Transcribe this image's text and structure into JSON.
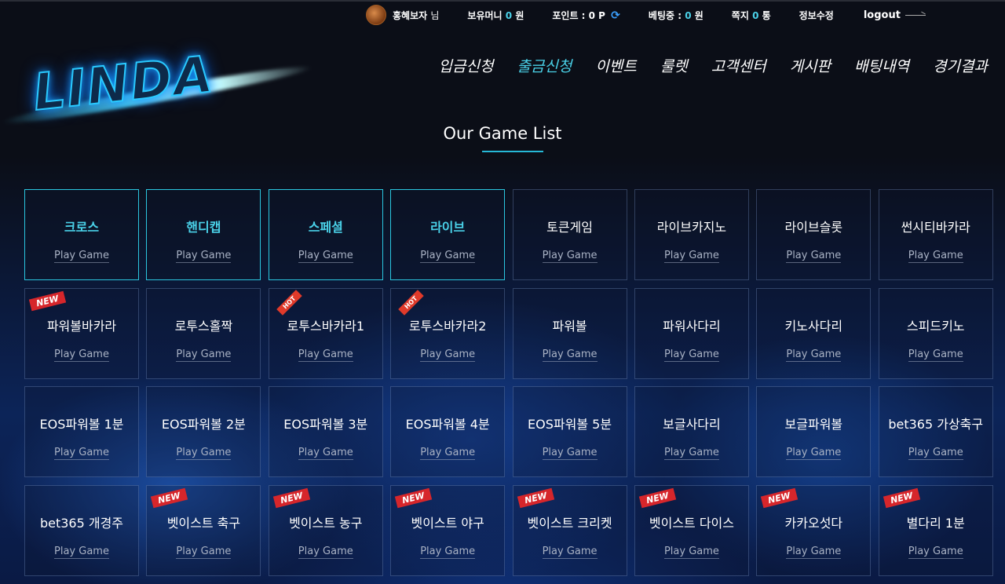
{
  "topbar": {
    "username": "홍혜보자",
    "user_suffix": "님",
    "money_label": "보유머니",
    "money_value": "0",
    "money_unit": "원",
    "point_label": "포인트 :",
    "point_value": "0 P",
    "betting_label": "베팅중 :",
    "betting_value": "0",
    "betting_unit": "원",
    "message_label": "쪽지",
    "message_value": "0",
    "message_unit": "통",
    "edit_label": "정보수정",
    "logout_label": "logout"
  },
  "logo": {
    "text": "LINDA"
  },
  "nav": {
    "items": [
      {
        "label": "입금신청"
      },
      {
        "label": "출금신청"
      },
      {
        "label": "이벤트"
      },
      {
        "label": "룰렛"
      },
      {
        "label": "고객센터"
      },
      {
        "label": "게시판"
      },
      {
        "label": "배팅내역"
      },
      {
        "label": "경기결과"
      }
    ]
  },
  "section": {
    "title": "Our Game List"
  },
  "games": [
    {
      "name": "크로스",
      "play": "Play Game"
    },
    {
      "name": "핸디캡",
      "play": "Play Game"
    },
    {
      "name": "스페셜",
      "play": "Play Game"
    },
    {
      "name": "라이브",
      "play": "Play Game"
    },
    {
      "name": "토큰게임",
      "play": "Play Game"
    },
    {
      "name": "라이브카지노",
      "play": "Play Game"
    },
    {
      "name": "라이브슬롯",
      "play": "Play Game"
    },
    {
      "name": "썬시티바카라",
      "play": "Play Game"
    },
    {
      "name": "파워볼바카라",
      "play": "Play Game",
      "badge": "NEW"
    },
    {
      "name": "로투스홀짝",
      "play": "Play Game"
    },
    {
      "name": "로투스바카라1",
      "play": "Play Game",
      "hot": "HOT"
    },
    {
      "name": "로투스바카라2",
      "play": "Play Game",
      "hot": "HOT"
    },
    {
      "name": "파워볼",
      "play": "Play Game"
    },
    {
      "name": "파워사다리",
      "play": "Play Game"
    },
    {
      "name": "키노사다리",
      "play": "Play Game"
    },
    {
      "name": "스피드키노",
      "play": "Play Game"
    },
    {
      "name": "EOS파워볼 1분",
      "play": "Play Game"
    },
    {
      "name": "EOS파워볼 2분",
      "play": "Play Game"
    },
    {
      "name": "EOS파워볼 3분",
      "play": "Play Game"
    },
    {
      "name": "EOS파워볼 4분",
      "play": "Play Game"
    },
    {
      "name": "EOS파워볼 5분",
      "play": "Play Game"
    },
    {
      "name": "보글사다리",
      "play": "Play Game"
    },
    {
      "name": "보글파워볼",
      "play": "Play Game"
    },
    {
      "name": "bet365 가상축구",
      "play": "Play Game"
    },
    {
      "name": "bet365 개경주",
      "play": "Play Game"
    },
    {
      "name": "벳이스트 축구",
      "play": "Play Game",
      "badge": "NEW"
    },
    {
      "name": "벳이스트 농구",
      "play": "Play Game",
      "badge": "NEW"
    },
    {
      "name": "벳이스트 야구",
      "play": "Play Game",
      "badge": "NEW"
    },
    {
      "name": "벳이스트 크리켓",
      "play": "Play Game",
      "badge": "NEW"
    },
    {
      "name": "벳이스트 다이스",
      "play": "Play Game",
      "badge": "NEW"
    },
    {
      "name": "카카오섯다",
      "play": "Play Game",
      "badge": "NEW"
    },
    {
      "name": "별다리 1분",
      "play": "Play Game",
      "badge": "NEW"
    }
  ],
  "colors": {
    "accent": "#4ad1e8",
    "badge": "#d6262b",
    "background": "#0b0e17"
  }
}
